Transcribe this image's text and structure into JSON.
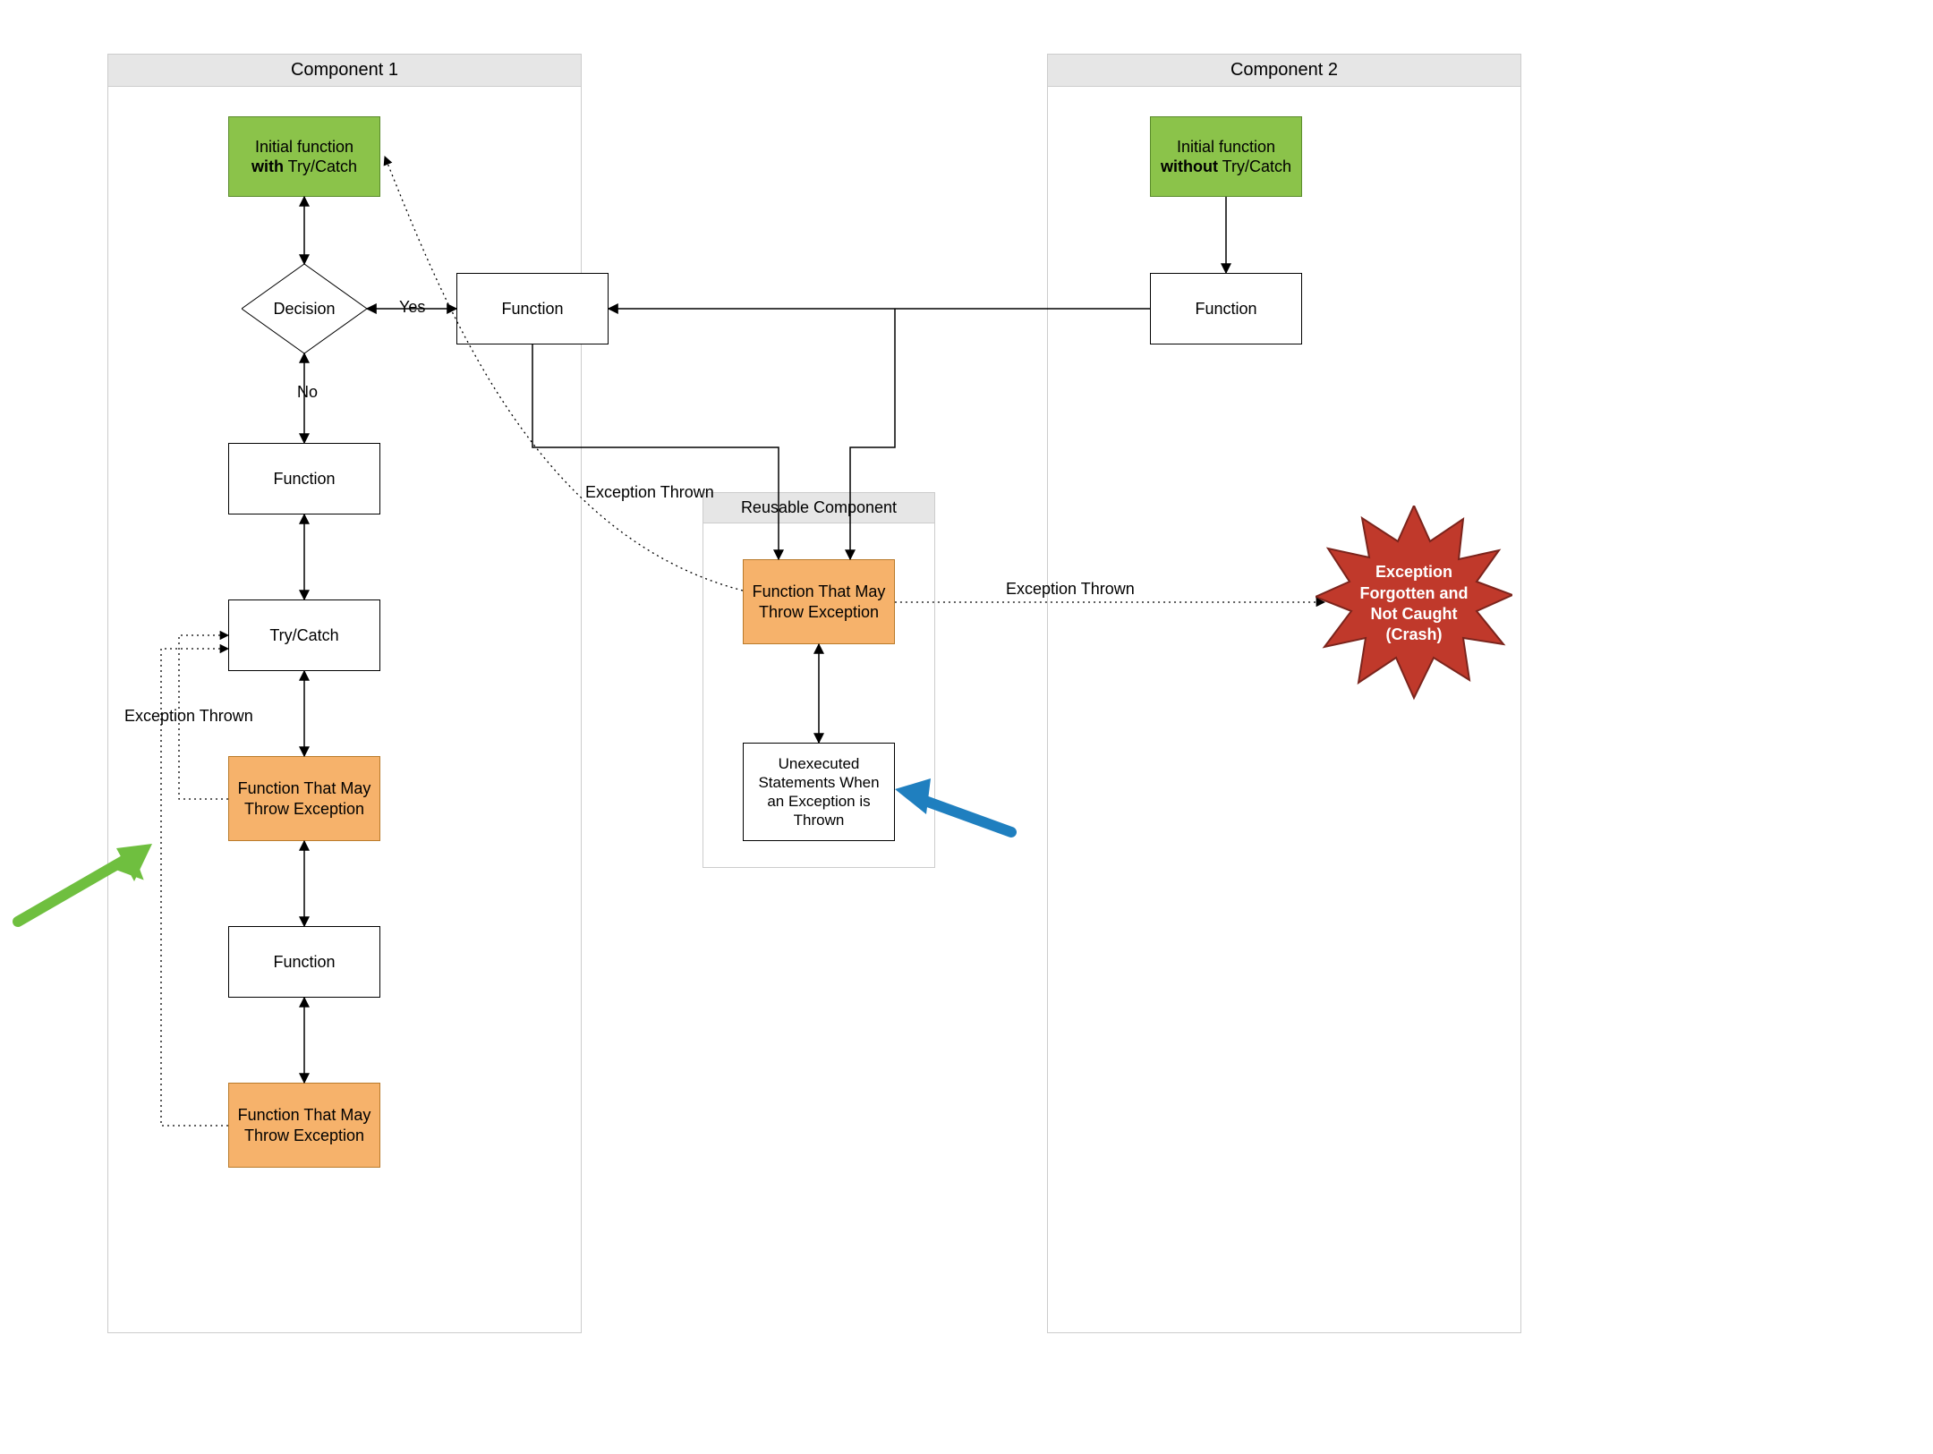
{
  "containers": {
    "component1": {
      "title": "Component 1"
    },
    "component2": {
      "title": "Component 2"
    },
    "reusable": {
      "title": "Reusable Component"
    }
  },
  "nodes": {
    "c1_initial_line1": "Initial function",
    "c1_initial_bold": "with",
    "c1_initial_line2": " Try/Catch",
    "decision_label": "Decision",
    "decision_yes": "Yes",
    "decision_no": "No",
    "c1_function_right": "Function",
    "c1_function_below": "Function",
    "c1_trycatch": "Try/Catch",
    "c1_fn_throw1": "Function That May Throw Exception",
    "c1_function_mid": "Function",
    "c1_fn_throw2": "Function That May Throw Exception",
    "reusable_fn_throw": "Function That May Throw Exception",
    "reusable_unexec": "Unexecuted Statements When an Exception is Thrown",
    "c2_initial_line1": "Initial function",
    "c2_initial_bold": "without",
    "c2_initial_line2": " Try/Catch",
    "c2_function": "Function",
    "crash_text": "Exception Forgotten and Not Caught (Crash)"
  },
  "edge_labels": {
    "exception_thrown_left": "Exception Thrown",
    "exception_thrown_mid": "Exception Thrown",
    "exception_thrown_right": "Exception Thrown"
  },
  "colors": {
    "green": "#8bc34a",
    "orange": "#f6b26b",
    "red": "#c0392b",
    "blue_arrow": "#1f7fbf",
    "green_arrow": "#6fbf3f"
  },
  "chart_data": {
    "type": "flowchart",
    "containers": [
      {
        "id": "component1",
        "title": "Component 1"
      },
      {
        "id": "component2",
        "title": "Component 2"
      },
      {
        "id": "reusable",
        "title": "Reusable Component"
      }
    ],
    "nodes": [
      {
        "id": "c1_initial",
        "container": "component1",
        "type": "process",
        "label": "Initial function with Try/Catch",
        "fill": "green"
      },
      {
        "id": "decision",
        "container": "component1",
        "type": "decision",
        "label": "Decision"
      },
      {
        "id": "c1_fn_right",
        "container": "component1",
        "type": "process",
        "label": "Function"
      },
      {
        "id": "c1_fn_below",
        "container": "component1",
        "type": "process",
        "label": "Function"
      },
      {
        "id": "c1_trycatch",
        "container": "component1",
        "type": "process",
        "label": "Try/Catch"
      },
      {
        "id": "c1_throw1",
        "container": "component1",
        "type": "process",
        "label": "Function That May Throw Exception",
        "fill": "orange"
      },
      {
        "id": "c1_fn_mid",
        "container": "component1",
        "type": "process",
        "label": "Function"
      },
      {
        "id": "c1_throw2",
        "container": "component1",
        "type": "process",
        "label": "Function That May Throw Exception",
        "fill": "orange"
      },
      {
        "id": "reusable_throw",
        "container": "reusable",
        "type": "process",
        "label": "Function That May Throw Exception",
        "fill": "orange"
      },
      {
        "id": "reusable_unexec",
        "container": "reusable",
        "type": "process",
        "label": "Unexecuted Statements When an Exception is Thrown"
      },
      {
        "id": "c2_initial",
        "container": "component2",
        "type": "process",
        "label": "Initial function without Try/Catch",
        "fill": "green"
      },
      {
        "id": "c2_fn",
        "container": "component2",
        "type": "process",
        "label": "Function"
      },
      {
        "id": "crash",
        "container": null,
        "type": "starburst",
        "label": "Exception Forgotten and Not Caught (Crash)",
        "fill": "red"
      }
    ],
    "edges": [
      {
        "from": "c1_initial",
        "to": "decision",
        "style": "solid",
        "bidirectional": true
      },
      {
        "from": "decision",
        "to": "c1_fn_right",
        "style": "solid",
        "bidirectional": true,
        "label": "Yes"
      },
      {
        "from": "decision",
        "to": "c1_fn_below",
        "style": "solid",
        "bidirectional": true,
        "label": "No"
      },
      {
        "from": "c1_fn_below",
        "to": "c1_trycatch",
        "style": "solid",
        "bidirectional": true
      },
      {
        "from": "c1_trycatch",
        "to": "c1_throw1",
        "style": "solid",
        "bidirectional": true
      },
      {
        "from": "c1_throw1",
        "to": "c1_fn_mid",
        "style": "solid",
        "bidirectional": true
      },
      {
        "from": "c1_fn_mid",
        "to": "c1_throw2",
        "style": "solid",
        "bidirectional": true
      },
      {
        "from": "c1_throw1",
        "to": "c1_trycatch",
        "style": "dotted",
        "label": "Exception Thrown"
      },
      {
        "from": "c1_throw2",
        "to": "c1_trycatch",
        "style": "dotted"
      },
      {
        "from": "c1_fn_right",
        "to": "reusable_throw",
        "style": "solid",
        "directed": true
      },
      {
        "from": "c2_fn",
        "to": "c1_fn_right",
        "style": "solid",
        "directed": true
      },
      {
        "from": "c2_fn",
        "to": "reusable_throw",
        "style": "solid",
        "directed": true
      },
      {
        "from": "reusable_throw",
        "to": "reusable_unexec",
        "style": "solid",
        "bidirectional": true
      },
      {
        "from": "reusable_throw",
        "to": "c1_initial",
        "style": "dotted",
        "label": "Exception Thrown"
      },
      {
        "from": "reusable_throw",
        "to": "crash",
        "style": "dotted",
        "label": "Exception Thrown"
      },
      {
        "from": "c2_initial",
        "to": "c2_fn",
        "style": "solid",
        "directed": true
      }
    ],
    "annotations": [
      {
        "type": "arrow",
        "color": "green",
        "points_to": "c1_throw1_area"
      },
      {
        "type": "arrow",
        "color": "blue",
        "points_to": "reusable_unexec"
      }
    ]
  }
}
